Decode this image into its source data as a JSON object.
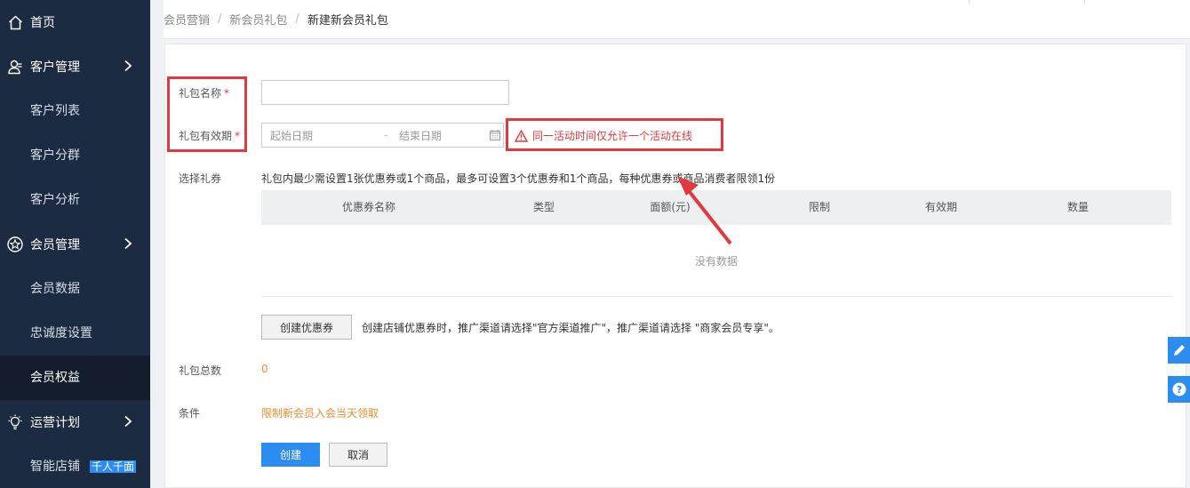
{
  "sidebar": {
    "home": "首页",
    "customer": "客户管理",
    "customer_list": "客户列表",
    "customer_group": "客户分群",
    "customer_analysis": "客户分析",
    "member": "会员管理",
    "member_data": "会员数据",
    "loyalty": "忠诚度设置",
    "member_rights": "会员权益",
    "ops": "运营计划",
    "smart_store": "智能店铺",
    "smart_badge": "千人千面"
  },
  "breadcrumb": [
    "会员营销",
    "新会员礼包",
    "新建新会员礼包"
  ],
  "breadcrumb_sep": "/",
  "form": {
    "name_label": "礼包名称",
    "validity_label": "礼包有效期",
    "required_mark": "*",
    "name_value": "",
    "start_placeholder": "起始日期",
    "end_placeholder": "结束日期",
    "date_sep": "-",
    "warning": "同一活动时间仅允许一个活动在线",
    "coupon_label": "选择礼券",
    "coupon_hint": "礼包内最少需设置1张优惠券或1个商品，最多可设置3个优惠券和1个商品，每种优惠券或商品消费者限领1份",
    "columns": [
      "优惠券名称",
      "类型",
      "面额(元)",
      "限制",
      "有效期",
      "数量"
    ],
    "empty_text": "没有数据",
    "create_coupon_btn": "创建优惠券",
    "create_coupon_hint": "创建店铺优惠券时，推广渠道请选择\"官方渠道推广\"，推广渠道请选择 \"商家会员专享\"。",
    "total_label": "礼包总数",
    "total_value": "0",
    "condition_label": "条件",
    "condition_value": "限制新会员入会当天领取",
    "submit_btn": "创建",
    "cancel_btn": "取消"
  },
  "colors": {
    "sidebar_bg": "#1c2b41",
    "accent": "#2d8cf0",
    "annotation_red": "#e0393e",
    "orange": "#f08c2e"
  },
  "icons": [
    "home-icon",
    "user-icon",
    "star-icon",
    "bulb-icon",
    "chevron-right-icon",
    "warning-icon",
    "calendar-icon",
    "edit-icon",
    "help-icon"
  ]
}
